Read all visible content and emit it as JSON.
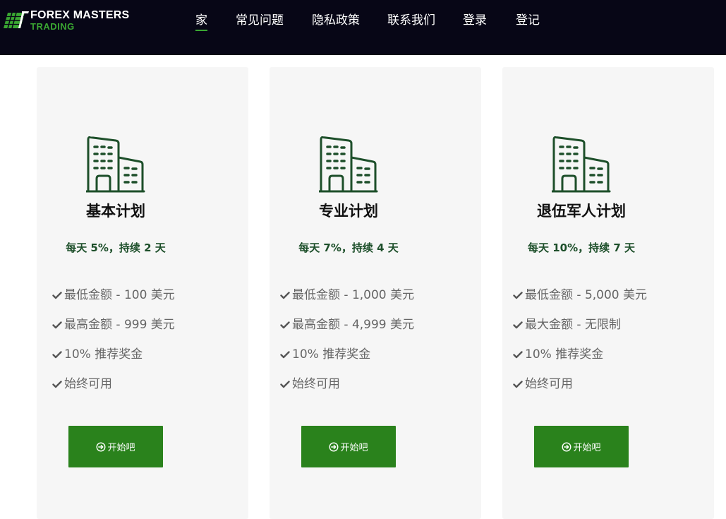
{
  "brand": {
    "name_line1": "FOREX MASTERS",
    "name_line2": "TRADING",
    "logo_icon": "green-grid-parallelogram-logo"
  },
  "nav": {
    "items": [
      {
        "label": "家",
        "active": true
      },
      {
        "label": "常见问题"
      },
      {
        "label": "隐私政策"
      },
      {
        "label": "联系我们"
      },
      {
        "label": "登录"
      },
      {
        "label": "登记"
      }
    ]
  },
  "plans": [
    {
      "title": "基本计划",
      "rate": "每天 5%，持续 2 天",
      "icon": "buildings-icon",
      "features": [
        "最低金额 - 100 美元",
        "最高金额 - 999 美元",
        "10% 推荐奖金",
        "始终可用"
      ],
      "button_label": "开始吧"
    },
    {
      "title": "专业计划",
      "rate": "每天 7%，持续 4 天",
      "icon": "buildings-icon",
      "features": [
        "最低金额 - 1,000 美元",
        "最高金额 - 4,999 美元",
        "10% 推荐奖金",
        "始终可用"
      ],
      "button_label": "开始吧"
    },
    {
      "title": "退伍军人计划",
      "rate": "每天 10%，持续 7 天",
      "icon": "buildings-icon",
      "features": [
        "最低金额 - 5,000 美元",
        "最大金额 - 无限制",
        "10% 推荐奖金",
        "始终可用"
      ],
      "button_label": "开始吧"
    }
  ],
  "colors": {
    "header_bg": "#070616",
    "accent_green": "#2a821c",
    "icon_green": "#1d4f2a",
    "card_bg": "#f6f6f6"
  }
}
